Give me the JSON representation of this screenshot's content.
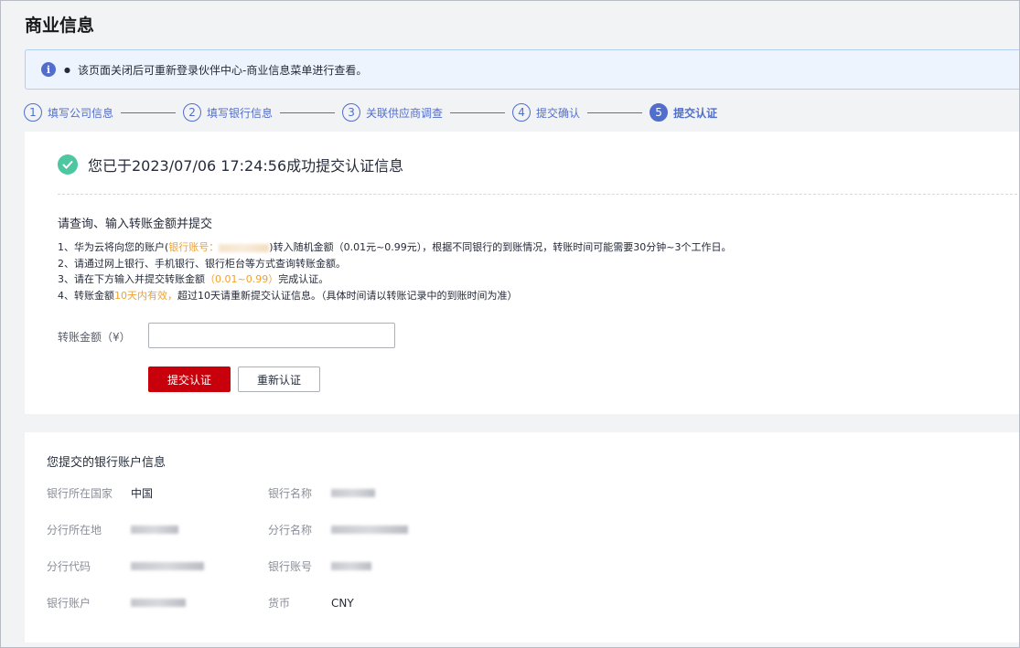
{
  "page": {
    "title": "商业信息"
  },
  "notice": {
    "text": "该页面关闭后可重新登录伙伴中心-商业信息菜单进行查看。"
  },
  "steps": [
    {
      "num": "1",
      "label": "填写公司信息"
    },
    {
      "num": "2",
      "label": "填写银行信息"
    },
    {
      "num": "3",
      "label": "关联供应商调查"
    },
    {
      "num": "4",
      "label": "提交确认"
    },
    {
      "num": "5",
      "label": "提交认证"
    }
  ],
  "verify": {
    "success_text": "您已于2023/07/06 17:24:56成功提交认证信息",
    "section_title": "请查询、输入转账金额并提交",
    "line1_a": "1、华为云将向您的账户(",
    "line1_hl": "银行账号：",
    "line1_b": ")转入随机金额（0.01元~0.99元），根据不同银行的到账情况，转账时间可能需要30分钟~3个工作日。",
    "line2": "2、请通过网上银行、手机银行、银行柜台等方式查询转账金额。",
    "line3_a": "3、请在下方输入并提交转账金额",
    "line3_hl": "（0.01~0.99）",
    "line3_b": "完成认证。",
    "line4_a": "4、转账金额",
    "line4_hl": "10天内有效，",
    "line4_b": "超过10天请重新提交认证信息。（具体时间请以转账记录中的到账时间为准）",
    "amount_label": "转账金额（¥）",
    "amount_value": "",
    "submit_label": "提交认证",
    "reset_label": "重新认证"
  },
  "bank_info": {
    "title": "您提交的银行账户信息",
    "country_label": "银行所在国家",
    "country_value": "中国",
    "bank_name_label": "银行名称",
    "branch_loc_label": "分行所在地",
    "branch_name_label": "分行名称",
    "branch_code_label": "分行代码",
    "account_no_label": "银行账号",
    "account_label": "银行账户",
    "currency_label": "货币",
    "currency_value": "CNY"
  },
  "colors": {
    "accent": "#526ecc",
    "primary_button": "#c7000b",
    "success": "#4cc7a1",
    "highlight": "#f2a12c"
  }
}
